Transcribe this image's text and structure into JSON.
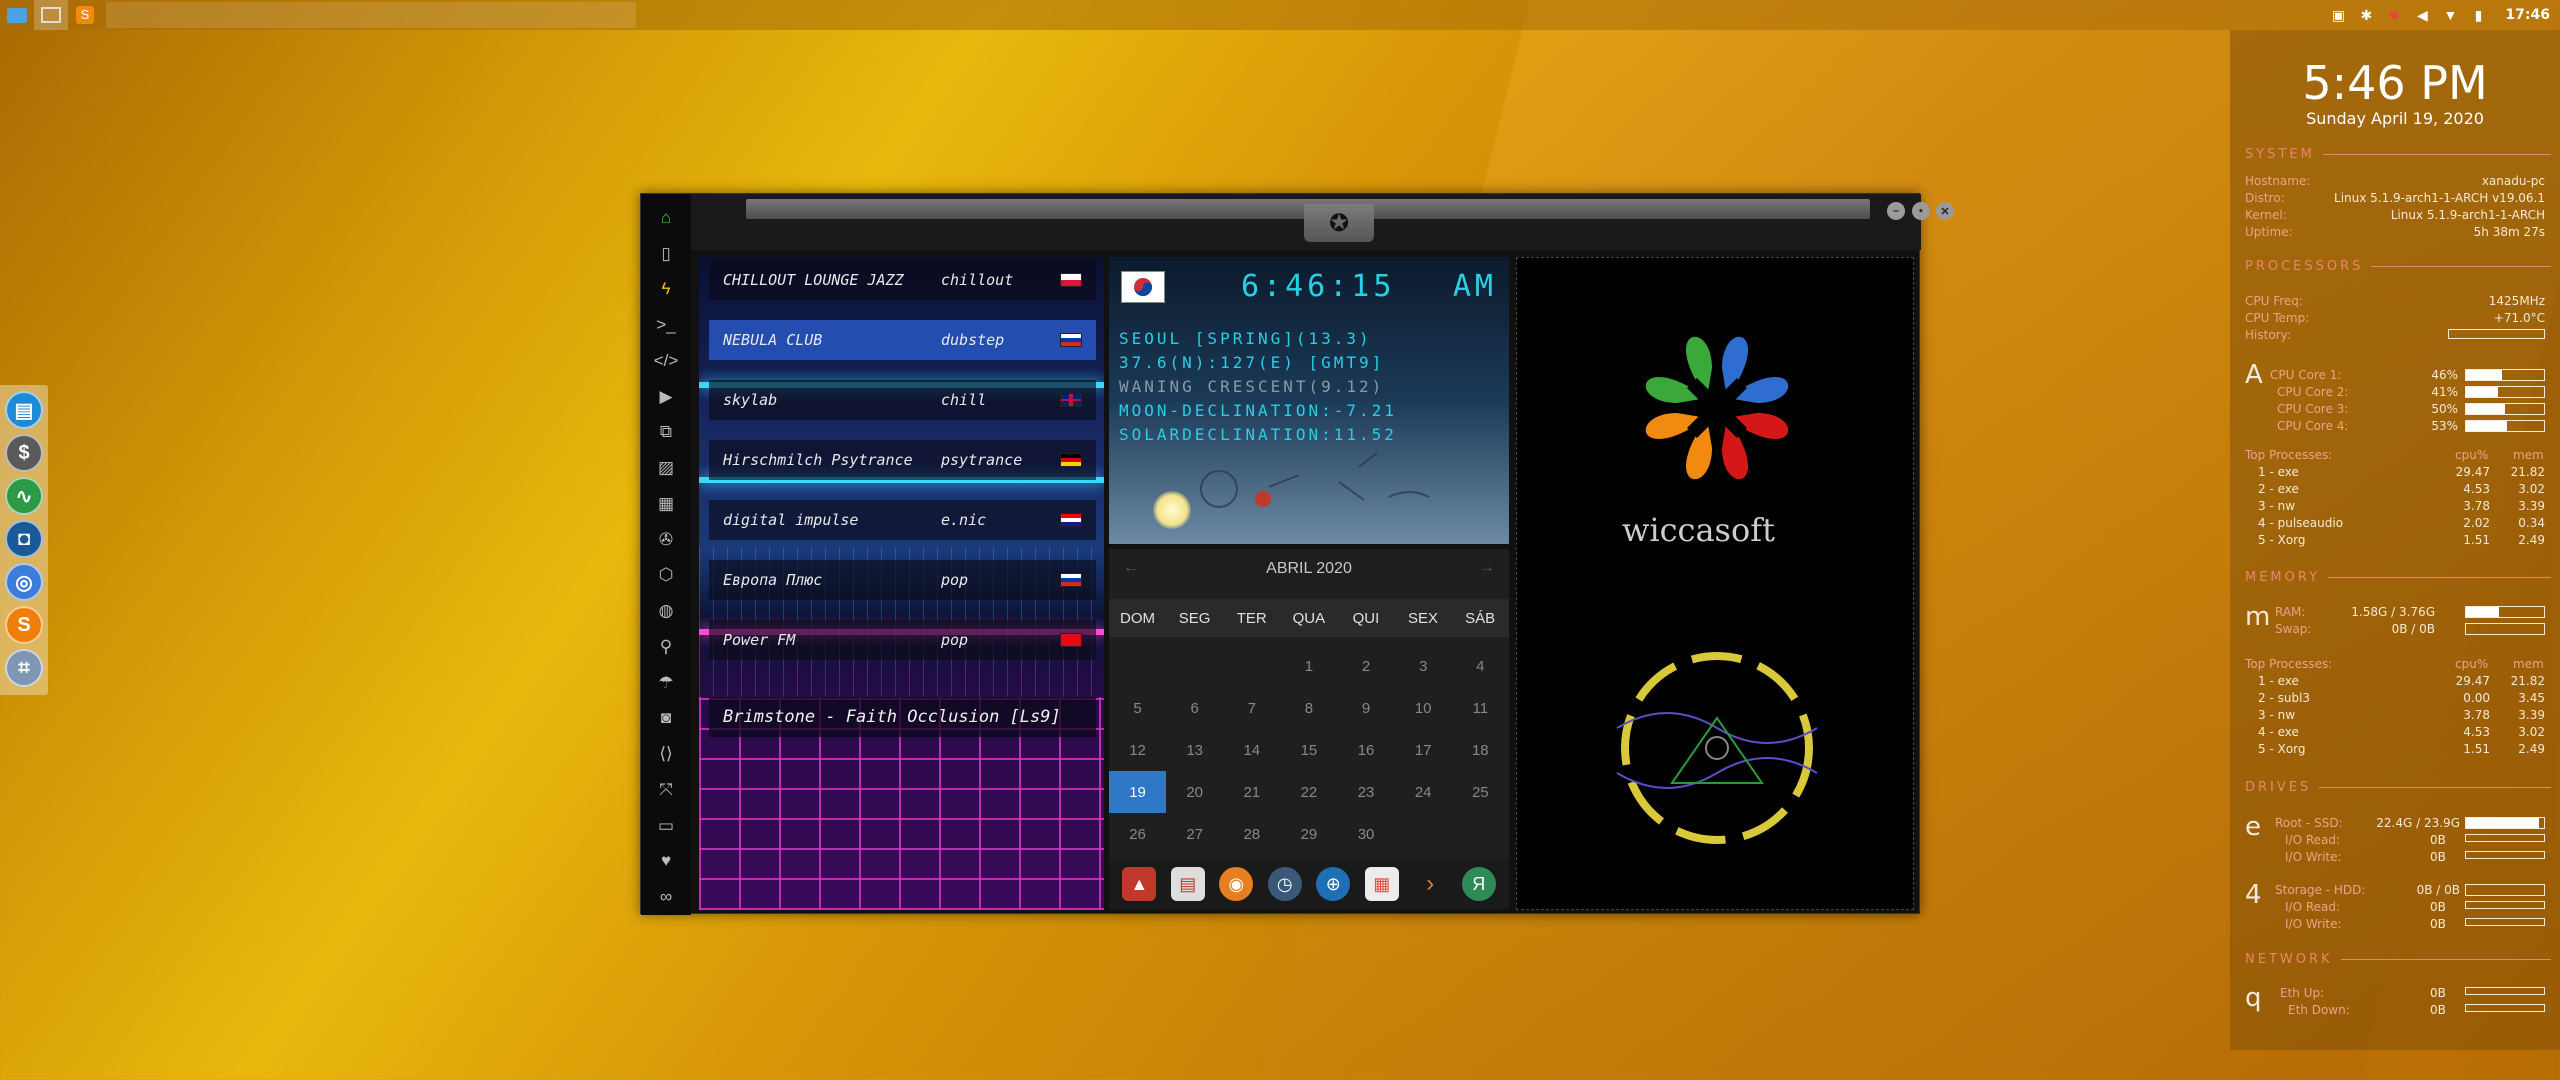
{
  "desktop": {
    "time": "17:46"
  },
  "conky": {
    "time": "5:46 PM",
    "date": "Sunday April 19, 2020",
    "system": {
      "header": "SYSTEM",
      "hostname_label": "Hostname:",
      "hostname": "xanadu-pc",
      "distro_label": "Distro:",
      "distro": "Linux 5.1.9-arch1-1-ARCH v19.06.1",
      "kernel_label": "Kernel:",
      "kernel": "Linux 5.1.9-arch1-1-ARCH",
      "uptime_label": "Uptime:",
      "uptime": "5h 38m 27s"
    },
    "processors": {
      "header": "PROCESSORS",
      "freq_label": "CPU Freq:",
      "freq": "1425MHz",
      "temp_label": "CPU Temp:",
      "temp": "+71.0°C",
      "history_label": "History:",
      "icon_letter": "A",
      "cores": [
        {
          "label": "CPU Core 1:",
          "value": "46%",
          "pct": 46
        },
        {
          "label": "CPU Core 2:",
          "value": "41%",
          "pct": 41
        },
        {
          "label": "CPU Core 3:",
          "value": "50%",
          "pct": 50
        },
        {
          "label": "CPU Core 4:",
          "value": "53%",
          "pct": 53
        }
      ],
      "top_label": "Top Processes:",
      "col1": "cpu%",
      "col2": "mem",
      "procs": [
        {
          "name": "1 - exe",
          "a": "29.47",
          "b": "21.82"
        },
        {
          "name": "2 - exe",
          "a": "4.53",
          "b": "3.02"
        },
        {
          "name": "3 - nw",
          "a": "3.78",
          "b": "3.39"
        },
        {
          "name": "4 - pulseaudio",
          "a": "2.02",
          "b": "0.34"
        },
        {
          "name": "5 - Xorg",
          "a": "1.51",
          "b": "2.49"
        }
      ]
    },
    "memory": {
      "header": "MEMORY",
      "icon_letter": "m",
      "ram_label": "RAM:",
      "ram": "1.58G / 3.76G",
      "ram_pct": 42,
      "swap_label": "Swap:",
      "swap": "0B / 0B",
      "swap_pct": 0,
      "top_label": "Top Processes:",
      "col1": "cpu%",
      "col2": "mem",
      "procs": [
        {
          "name": "1 - exe",
          "a": "29.47",
          "b": "21.82"
        },
        {
          "name": "2 - subl3",
          "a": "0.00",
          "b": "3.45"
        },
        {
          "name": "3 - nw",
          "a": "3.78",
          "b": "3.39"
        },
        {
          "name": "4 - exe",
          "a": "4.53",
          "b": "3.02"
        },
        {
          "name": "5 - Xorg",
          "a": "1.51",
          "b": "2.49"
        }
      ]
    },
    "drives": {
      "header": "DRIVES",
      "icon1": "e",
      "root_label": "Root - SSD:",
      "root": "22.4G / 23.9G",
      "root_pct": 94,
      "io_read_label": "I/O Read:",
      "io_read": "0B",
      "io_write_label": "I/O Write:",
      "io_write": "0B",
      "icon2": "4",
      "storage_label": "Storage - HDD:",
      "storage": "0B / 0B",
      "storage_pct": 0,
      "io_read2": "0B",
      "io_write2": "0B"
    },
    "network": {
      "header": "NETWORK",
      "icon_letter": "q",
      "up_label": "Eth Up:",
      "up": "0B",
      "down_label": "Eth Down:",
      "down": "0B"
    }
  },
  "radio": {
    "stations": [
      {
        "name": "CHILLOUT LOUNGE JAZZ",
        "genre": "chillout",
        "flag": "poland"
      },
      {
        "name": "NEBULA CLUB",
        "genre": "dubstep",
        "flag": "russia"
      },
      {
        "name": "skylab",
        "genre": "chill",
        "flag": "uk"
      },
      {
        "name": "Hirschmilch Psytrance",
        "genre": "psytrance",
        "flag": "germany"
      },
      {
        "name": "digital impulse",
        "genre": "e.nic",
        "flag": "croatia"
      },
      {
        "name": "Европа Плюс",
        "genre": "pop",
        "flag": "russia"
      },
      {
        "name": "Power FM",
        "genre": "pop",
        "flag": "turkey"
      }
    ],
    "now_playing": "Brimstone - Faith Occlusion [Ls9]"
  },
  "worldclock": {
    "time": "6:46:15",
    "ampm": "AM",
    "line1": "SEOUL [SPRING](13.3)",
    "line2": "37.6(N):127(E) [GMT9]",
    "line3": "WANING CRESCENT(9.12)",
    "line4": "MOON-DECLINATION:-7.21",
    "line5": "SOLARDECLINATION:11.52"
  },
  "calendar": {
    "month": "ABRIL 2020",
    "dow": [
      "DOM",
      "SEG",
      "TER",
      "QUA",
      "QUI",
      "SEX",
      "SÁB"
    ],
    "days": [
      "",
      "",
      "",
      "1",
      "2",
      "3",
      "4",
      "5",
      "6",
      "7",
      "8",
      "9",
      "10",
      "11",
      "12",
      "13",
      "14",
      "15",
      "16",
      "17",
      "18",
      "19",
      "20",
      "21",
      "22",
      "23",
      "24",
      "25",
      "26",
      "27",
      "28",
      "29",
      "30",
      "",
      ""
    ],
    "today": "19"
  },
  "logo": {
    "text": "wiccasoft"
  }
}
